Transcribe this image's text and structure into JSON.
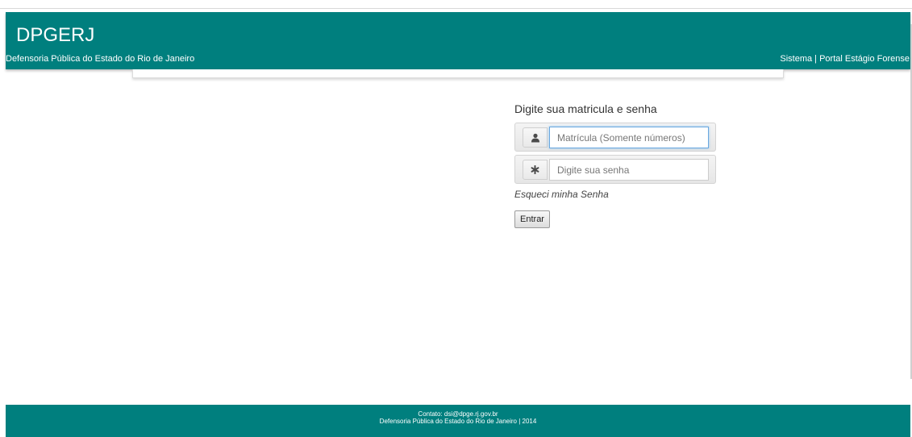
{
  "header": {
    "title": "DPGERJ",
    "subtitle": "Defensoria Pública do Estado do Rio de Janeiro",
    "system_label": "Sistema | Portal Estágio Forense"
  },
  "login": {
    "heading": "Digite sua matricula e senha",
    "username": {
      "value": "",
      "placeholder": "Matrícula (Somente números)",
      "icon": "user-icon"
    },
    "password": {
      "value": "",
      "placeholder": "Digite sua senha",
      "icon": "asterisk-icon"
    },
    "forgot_link": "Esqueci minha Senha",
    "submit_label": "Entrar"
  },
  "footer": {
    "contact": "Contato: dsi@dpge.rj.gov.br",
    "copyright": "Defensoria Pública do Estado do Rio de Janeiro | 2014"
  },
  "colors": {
    "brand": "#007f7e",
    "focus": "#6aa8e0"
  }
}
